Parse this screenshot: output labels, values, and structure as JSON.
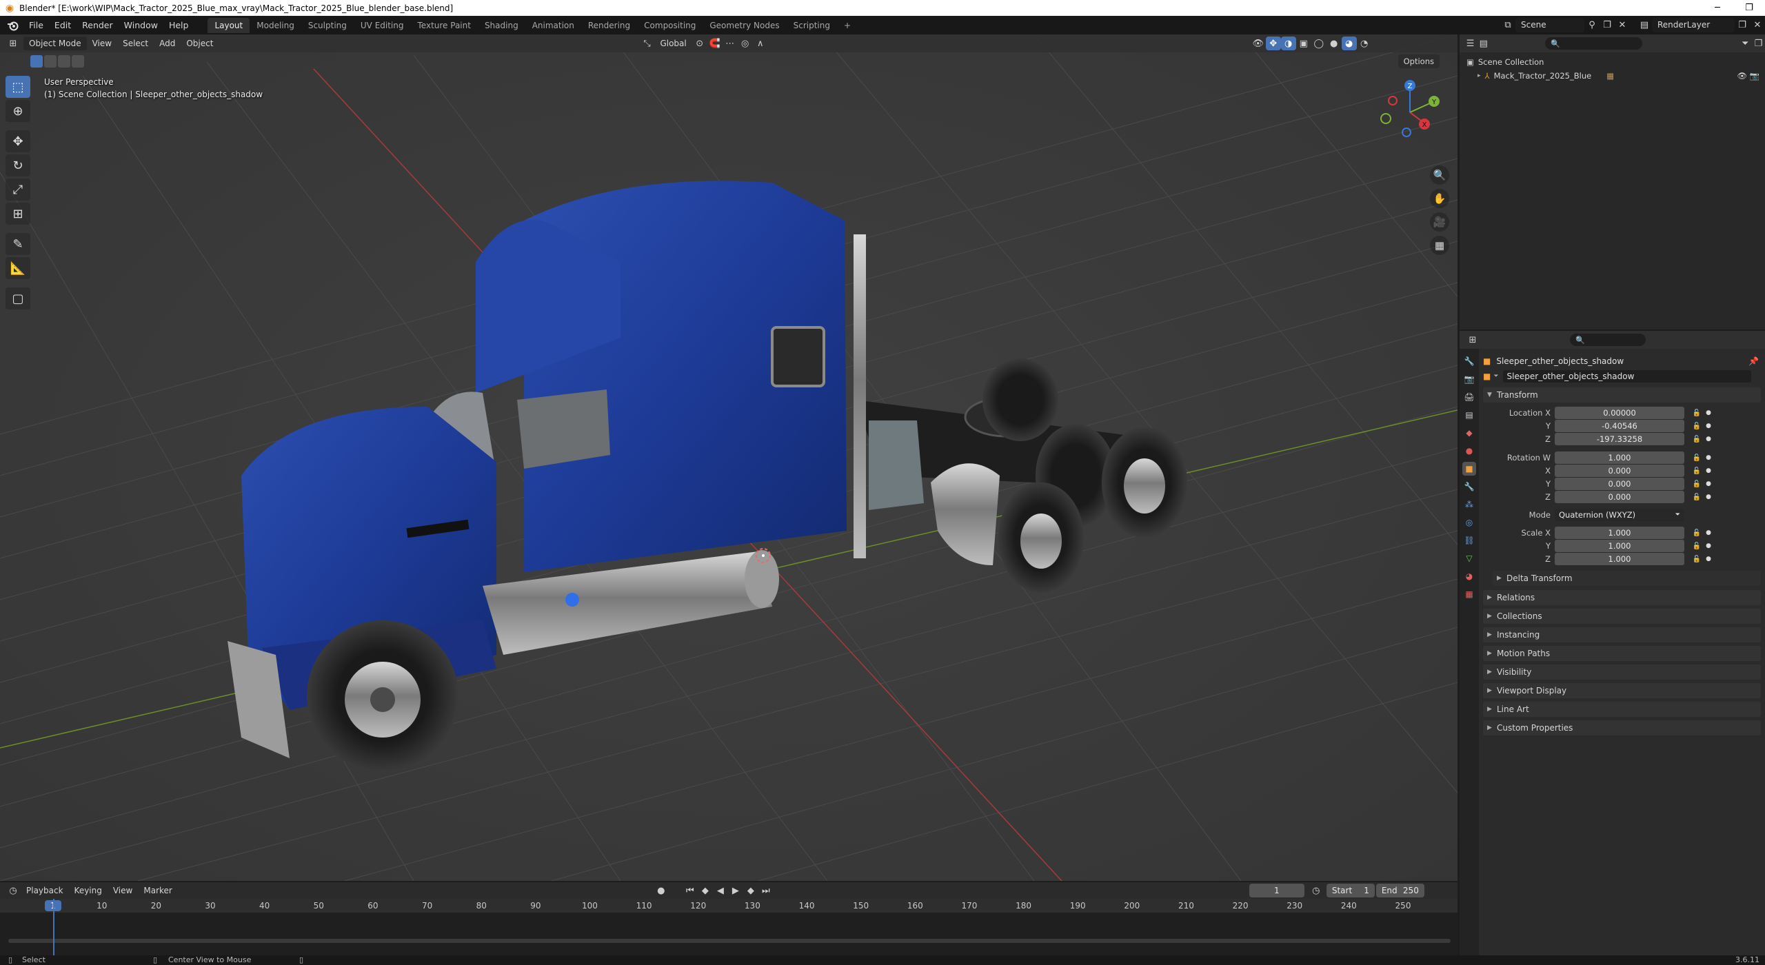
{
  "window": {
    "title": "Blender* [E:\\work\\WIP\\Mack_Tractor_2025_Blue_max_vray\\Mack_Tractor_2025_Blue_blender_base.blend]",
    "minimize": "─",
    "maximize": "❐",
    "close": "✕"
  },
  "menu": [
    "File",
    "Edit",
    "Render",
    "Window",
    "Help"
  ],
  "workspaces": [
    "Layout",
    "Modeling",
    "Sculpting",
    "UV Editing",
    "Texture Paint",
    "Shading",
    "Animation",
    "Rendering",
    "Compositing",
    "Geometry Nodes",
    "Scripting"
  ],
  "active_workspace": "Layout",
  "add_workspace": "+",
  "scene": {
    "name": "Scene",
    "render_layer": "RenderLayer"
  },
  "viewport": {
    "mode": "Object Mode",
    "menus": [
      "View",
      "Select",
      "Add",
      "Object"
    ],
    "transform_orientation": "Global",
    "options_label": "Options",
    "view_name": "User Perspective",
    "collection_path": "(1) Scene Collection | Sleeper_other_objects_shadow",
    "gizmo_axes": {
      "z": "Z",
      "y": "Y",
      "x": "X"
    }
  },
  "timeline": {
    "menus": [
      "Playback",
      "Keying",
      "View",
      "Marker"
    ],
    "current_frame": "1",
    "start_label": "Start",
    "start": "1",
    "end_label": "End",
    "end": "250",
    "ruler": [
      "1",
      "10",
      "20",
      "30",
      "40",
      "50",
      "60",
      "70",
      "80",
      "90",
      "100",
      "110",
      "120",
      "130",
      "140",
      "150",
      "160",
      "170",
      "180",
      "190",
      "200",
      "210",
      "220",
      "230",
      "240",
      "250"
    ]
  },
  "outliner": {
    "root": "Scene Collection",
    "items": [
      {
        "name": "Mack_Tractor_2025_Blue"
      }
    ]
  },
  "properties": {
    "object_name": "Sleeper_other_objects_shadow",
    "data_name": "Sleeper_other_objects_shadow",
    "transform_title": "Transform",
    "location": {
      "label": "Location X",
      "x": "0.00000",
      "y": "-0.40546",
      "z": "-197.33258"
    },
    "rotation": {
      "label": "Rotation W",
      "w": "1.000",
      "x": "0.000",
      "y": "0.000",
      "z": "0.000"
    },
    "axis_labels": {
      "x": "X",
      "y": "Y",
      "z": "Z"
    },
    "mode_label": "Mode",
    "mode_value": "Quaternion (WXYZ)",
    "scale": {
      "label": "Scale X",
      "x": "1.000",
      "y": "1.000",
      "z": "1.000"
    },
    "delta_transform": "Delta Transform",
    "collapsed_panels": [
      "Relations",
      "Collections",
      "Instancing",
      "Motion Paths",
      "Visibility",
      "Viewport Display",
      "Line Art",
      "Custom Properties"
    ]
  },
  "status": {
    "select": "Select",
    "center_view": "Center View to Mouse",
    "version": "3.6.11"
  }
}
